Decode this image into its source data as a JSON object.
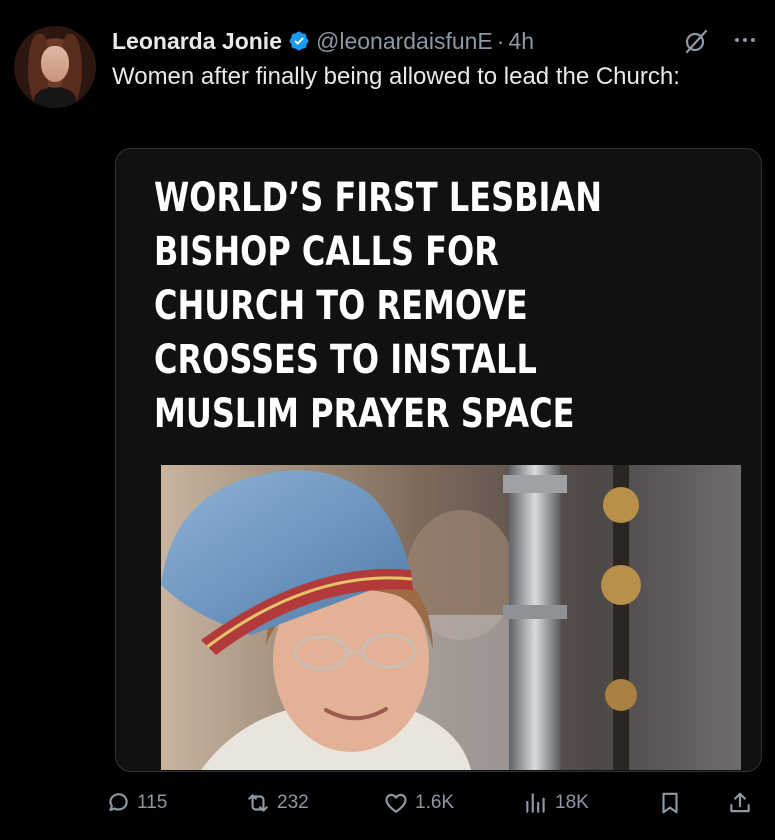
{
  "author": {
    "display_name": "Leonarda Jonie",
    "handle": "@leonardaisfunE",
    "separator": "·",
    "time": "4h"
  },
  "post": {
    "text": "Women after finally being allowed to lead the Church:"
  },
  "media": {
    "headline": "WORLD’S FIRST LESBIAN BISHOP CALLS FOR CHURCH TO REMOVE CROSSES TO INSTALL MUSLIM PRAYER SPACE"
  },
  "icons": {
    "verified": "verified-badge-icon",
    "grok": "grok-icon",
    "more": "more-options-icon",
    "reply": "reply-icon",
    "repost": "repost-icon",
    "like": "like-icon",
    "views": "views-icon",
    "bookmark": "bookmark-icon",
    "share": "share-icon"
  },
  "stats": {
    "replies": "115",
    "reposts": "232",
    "likes": "1.6K",
    "views": "18K"
  },
  "colors": {
    "background": "#000000",
    "text": "#e7e9ea",
    "muted": "#8b98a5",
    "verified": "#1d9bf0"
  }
}
